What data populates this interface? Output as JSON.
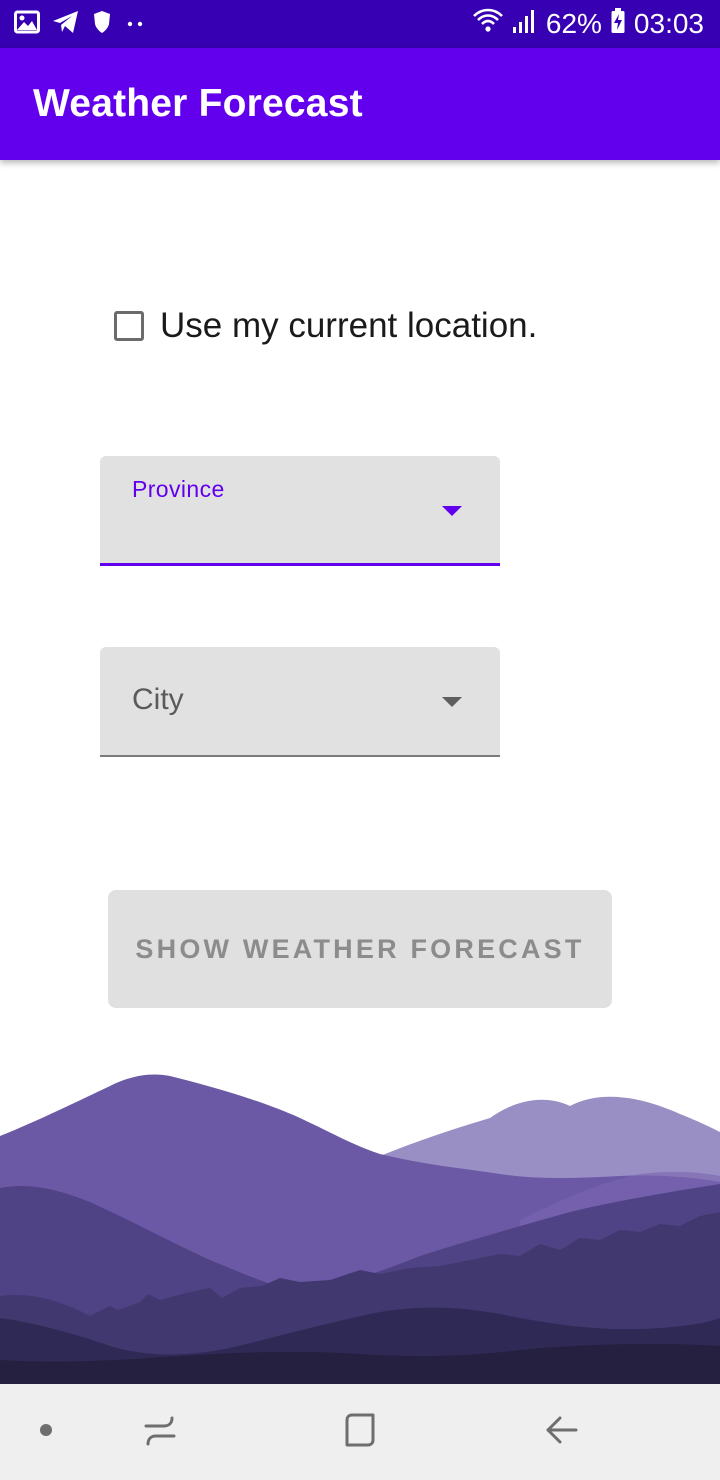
{
  "status_bar": {
    "battery_percent": "62%",
    "time": "03:03",
    "left_icons": [
      "gallery-icon",
      "telegram-icon",
      "shield-icon",
      "more-dots-icon"
    ],
    "right_icons": [
      "wifi-icon",
      "signal-icon",
      "battery-charging-icon"
    ]
  },
  "app_bar": {
    "title": "Weather Forecast",
    "color": "#6200ee"
  },
  "location_checkbox": {
    "label": "Use my current location.",
    "checked": false
  },
  "province_dropdown": {
    "label": "Province",
    "selected_value": "",
    "focused": true
  },
  "city_dropdown": {
    "label": "City",
    "selected_value": "",
    "focused": false
  },
  "forecast_button": {
    "label": "SHOW WEATHER FORECAST",
    "enabled": false
  },
  "navigation_bar": {
    "items": [
      "dot-icon",
      "recent-apps-icon",
      "home-icon",
      "back-icon"
    ]
  },
  "colors": {
    "accent": "#6200ee",
    "status_bar": "#3700b3",
    "mountain_back": "#9a8fc4",
    "mountain_front": "#252040"
  }
}
